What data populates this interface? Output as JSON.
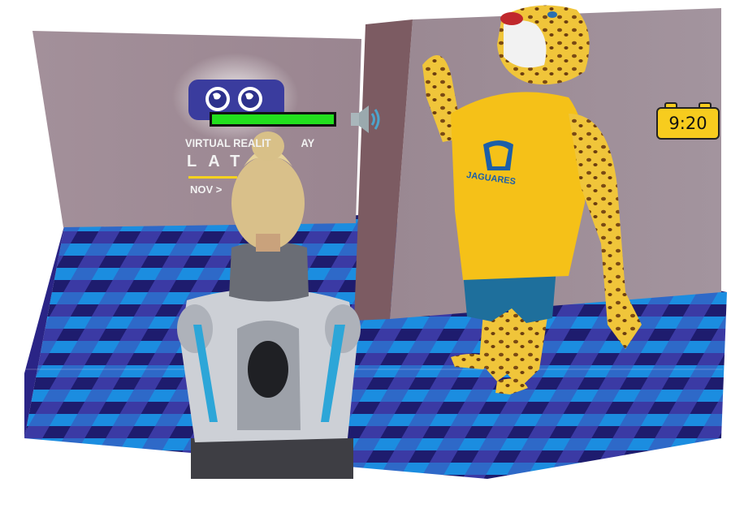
{
  "hud": {
    "clock_time": "9:20",
    "health_fraction": 1.0,
    "icons": {
      "sound": "speaker-volume-icon",
      "clock": "alarm-clock-icon"
    }
  },
  "wall_banner": {
    "line1": "VIRTUAL REALIT",
    "line1b": "AY",
    "line2": "LAT",
    "line3": "NOV > ",
    "logo": "vr-headset-globe-logo"
  },
  "mascot": {
    "shirt_text": "JAGUARES"
  },
  "colors": {
    "wall": "#9f8b8e",
    "floor_dark": "#241e7c",
    "floor_light": "#1a8fe0",
    "mascot_shirt": "#f5c118",
    "health": "#22e01e"
  }
}
